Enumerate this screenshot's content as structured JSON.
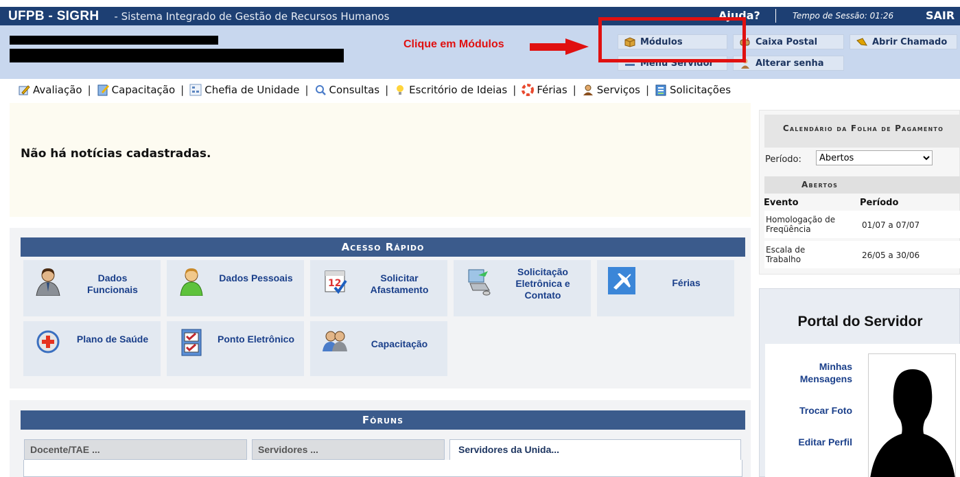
{
  "header": {
    "system": "UFPB - SIGRH",
    "system_name": "- Sistema Integrado de Gestão de Recursos Humanos",
    "help": "Ajuda?",
    "session": "Tempo de Sessão: 01:26",
    "logout": "SAIR"
  },
  "annotation": {
    "text": "Clique em Módulos",
    "color": "#e01010"
  },
  "toolbar": {
    "modulos": "Módulos",
    "caixa_postal": "Caixa Postal",
    "abrir_chamado": "Abrir Chamado",
    "menu_servidor": "Menu Servidor",
    "alterar_senha": "Alterar senha"
  },
  "menu": [
    {
      "label": "Avaliação",
      "icon": "edit-icon"
    },
    {
      "label": "Capacitação",
      "icon": "document-icon"
    },
    {
      "label": "Chefia de Unidade",
      "icon": "org-chart-icon"
    },
    {
      "label": "Consultas",
      "icon": "search-icon"
    },
    {
      "label": "Escritório de Ideias",
      "icon": "lightbulb-icon"
    },
    {
      "label": "Férias",
      "icon": "lifebuoy-icon"
    },
    {
      "label": "Serviços",
      "icon": "user-icon"
    },
    {
      "label": "Solicitações",
      "icon": "form-icon"
    }
  ],
  "news": {
    "message": "Não há notícias cadastradas."
  },
  "quick_access": {
    "title": "Acesso Rápido",
    "items": [
      {
        "label": "Dados Funcionais",
        "icon": "employee-icon"
      },
      {
        "label": "Dados Pessoais",
        "icon": "person-icon"
      },
      {
        "label": "Solicitar Afastamento",
        "icon": "calendar-icon"
      },
      {
        "label": "Solicitação Eletrônica e Contato",
        "icon": "computer-icon"
      },
      {
        "label": "Férias",
        "icon": "airplane-icon"
      },
      {
        "label": "Plano de Saúde",
        "icon": "health-plus-icon"
      },
      {
        "label": "Ponto Eletrônico",
        "icon": "checklist-icon"
      },
      {
        "label": "Capacitação",
        "icon": "group-icon"
      }
    ]
  },
  "forums": {
    "title": "Fóruns",
    "tabs": [
      "Docente/TAE ...",
      "Servidores ...",
      "Servidores da Unida..."
    ]
  },
  "calendar": {
    "title": "Calendário da Folha de Pagamento",
    "period_label": "Período:",
    "period_value": "Abertos",
    "section": "Abertos",
    "col_event": "Evento",
    "col_period": "Período",
    "rows": [
      {
        "event": "Homologação de Freqüência",
        "period": "01/07 a 07/07"
      },
      {
        "event": "Escala de Trabalho",
        "period": "26/05 a 30/06"
      }
    ]
  },
  "portal": {
    "title": "Portal do Servidor",
    "links": [
      "Minhas Mensagens",
      "Trocar Foto",
      "Editar Perfil"
    ]
  }
}
